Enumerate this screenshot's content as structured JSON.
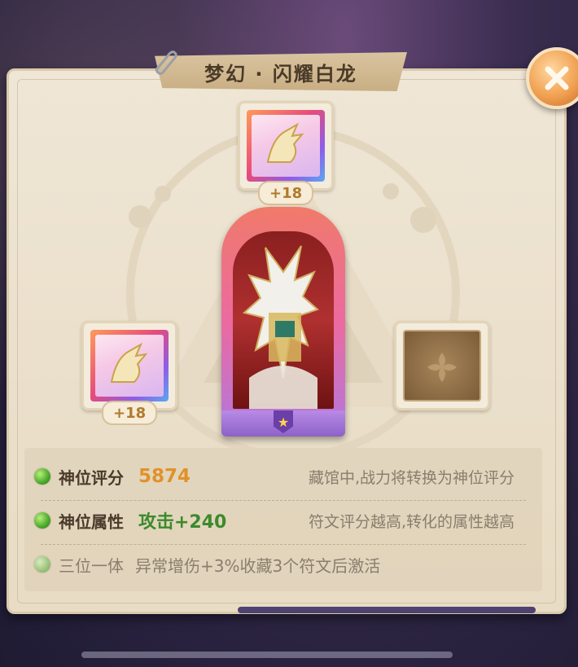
{
  "title": "梦幻 · 闪耀白龙",
  "slots": {
    "top": {
      "badge": "+18"
    },
    "left": {
      "badge": "+18"
    }
  },
  "stats": [
    {
      "label": "神位评分",
      "value": "5874",
      "note": "藏馆中,战力将转换为神位评分"
    },
    {
      "label": "神位属性",
      "value": "攻击+240",
      "note": "符文评分越高,转化的属性越高"
    },
    {
      "label": "三位一体",
      "value": "异常增伤+3%收藏3个符文后激活"
    }
  ],
  "colors": {
    "value_orange": "#e0922a",
    "value_green": "#3c8a2c",
    "close_button": "#f0a050"
  },
  "icons": {
    "close": "x-icon",
    "star": "star-icon",
    "clip": "paperclip-icon",
    "bullet": "green-orb-icon"
  }
}
